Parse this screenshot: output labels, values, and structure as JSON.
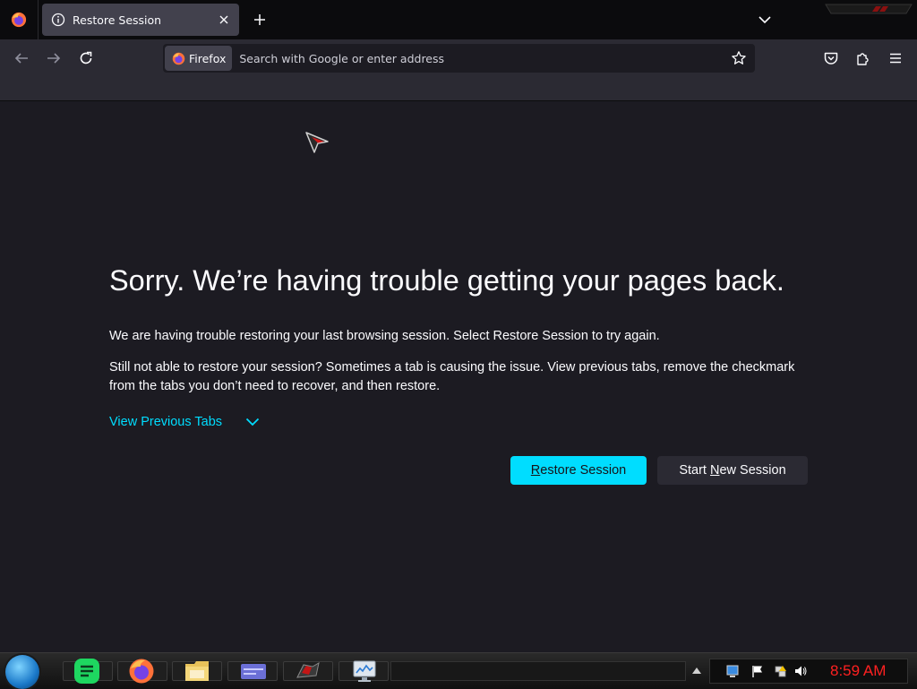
{
  "tab": {
    "title": "Restore Session"
  },
  "urlbar": {
    "identity_label": "Firefox",
    "placeholder": "Search with Google or enter address"
  },
  "page": {
    "heading": "Sorry. We’re having trouble getting your pages back.",
    "para1": "We are having trouble restoring your last browsing session. Select Restore Session to try again.",
    "para2": "Still not able to restore your session? Sometimes a tab is causing the issue. View previous tabs, remove the checkmark from the tabs you don’t need to recover, and then restore.",
    "view_previous": "View Previous Tabs",
    "restore_button": {
      "accesskey": "R",
      "rest": "estore Session"
    },
    "new_session_button": {
      "pre": "Start ",
      "accesskey": "N",
      "rest": "ew Session"
    }
  },
  "taskbar": {
    "clock": "8:59 AM"
  },
  "colors": {
    "background": "#1c1b22",
    "toolbar": "#2b2a33",
    "accent": "#00ddff",
    "clock": "#ff2020"
  },
  "icons": {
    "tabstrip": [
      "firefox-logo-icon",
      "info-icon",
      "close-icon",
      "plus-icon",
      "chevron-down-icon"
    ],
    "navbar": [
      "back-arrow-icon",
      "forward-arrow-icon",
      "reload-icon",
      "firefox-logo-icon",
      "star-icon",
      "pocket-icon",
      "extensions-icon",
      "hamburger-menu-icon"
    ],
    "taskbar": [
      "start-orb-icon",
      "notes-icon",
      "firefox-logo-icon",
      "file-manager-icon",
      "window-icon",
      "media-icon",
      "monitor-icon"
    ],
    "tray": [
      "display-icon",
      "flag-icon",
      "network-icon",
      "volume-icon"
    ]
  }
}
